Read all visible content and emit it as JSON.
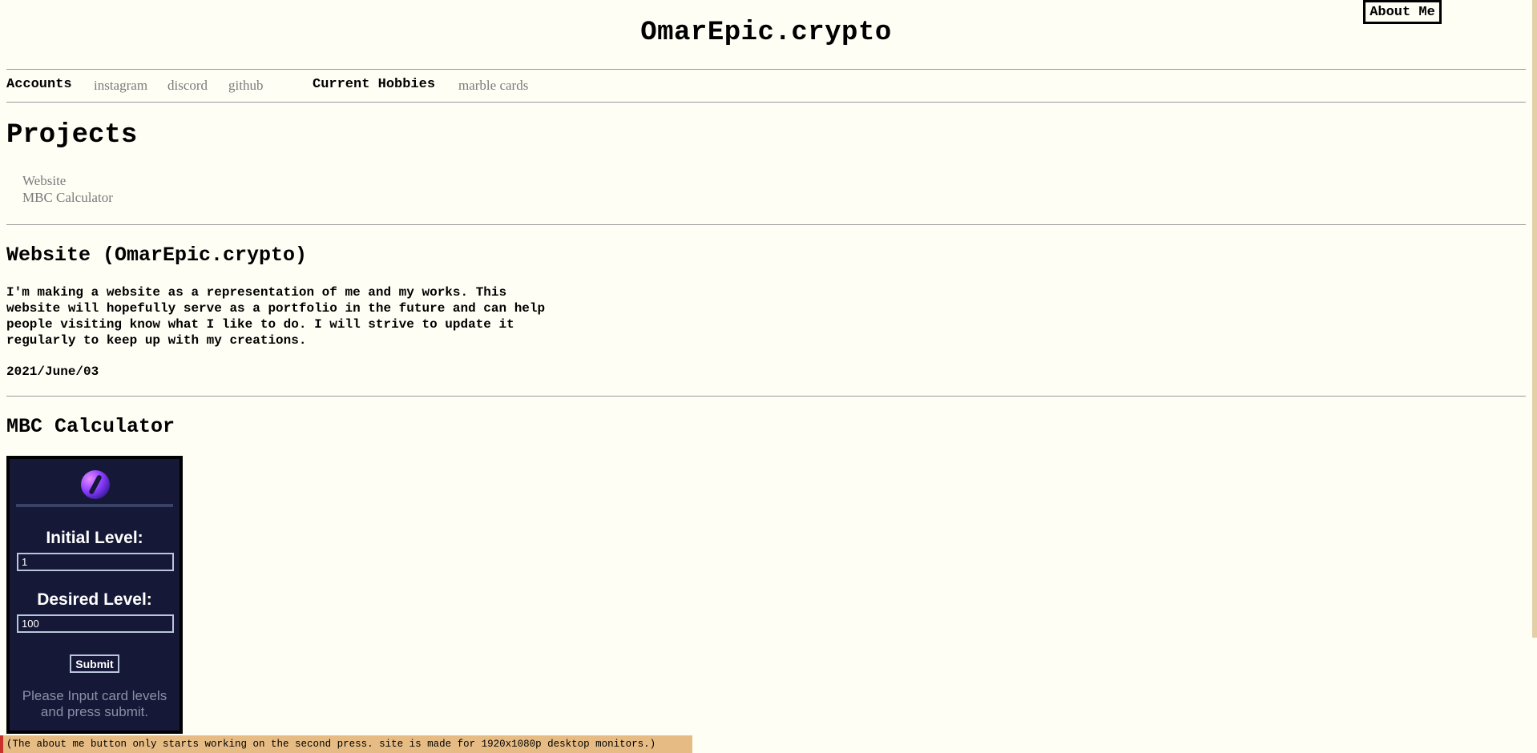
{
  "header": {
    "site_title": "OmarEpic.crypto",
    "about_button": "About Me"
  },
  "nav": {
    "accounts_label": "Accounts",
    "accounts_links": [
      "instagram",
      "discord",
      "github"
    ],
    "hobbies_label": "Current Hobbies",
    "hobbies_links": [
      "marble cards"
    ]
  },
  "projects": {
    "heading": "Projects",
    "links": [
      "Website",
      "MBC Calculator"
    ]
  },
  "website_section": {
    "title": "Website (OmarEpic.crypto)",
    "description_lines": [
      "I'm making a website as a representation of me and my works. This",
      "website will hopefully serve as a portfolio in the future and can help",
      "people visiting know what I like to do. I will strive to update it",
      "regularly to keep up with my creations."
    ],
    "date": "2021/June/03"
  },
  "calculator_section": {
    "title": "MBC Calculator",
    "initial_label": "Initial Level:",
    "initial_value": "1",
    "desired_label": "Desired Level:",
    "desired_value": "100",
    "submit_label": "Submit",
    "message_lines": [
      "Please Input card levels",
      "and press submit."
    ]
  },
  "notice": "(The about me button only starts working on the second press. site is made for 1920x1080p desktop monitors.)",
  "colors": {
    "page_background": "#fffef5",
    "link_gray": "#7a7a7a",
    "calculator_background": "#151836",
    "notice_background": "#e7bc84",
    "notice_accent": "#c9322a"
  }
}
